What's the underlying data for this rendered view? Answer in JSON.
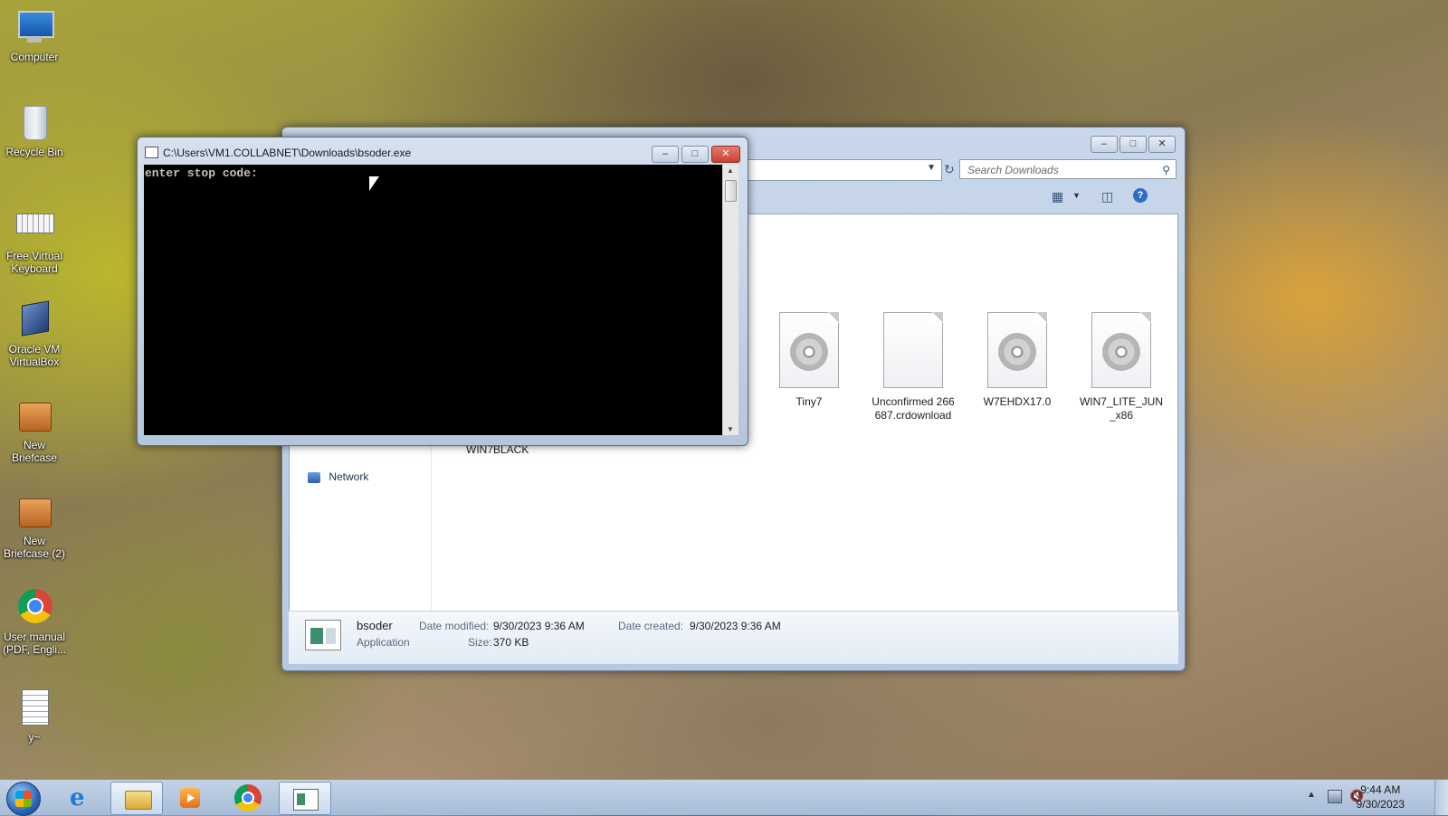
{
  "desktop": {
    "icons": [
      {
        "label": "Computer"
      },
      {
        "label": "Recycle Bin"
      },
      {
        "label": "Free Virtual Keyboard"
      },
      {
        "label": "Oracle VM VirtualBox"
      },
      {
        "label": "New Briefcase"
      },
      {
        "label": "New Briefcase (2)"
      },
      {
        "label": "User manual (PDF, Engli..."
      },
      {
        "label": "y~"
      }
    ]
  },
  "explorer": {
    "search_placeholder": "Search Downloads",
    "nav_network": "Network",
    "partial_item": "WIN7BLACK",
    "files": [
      {
        "name": "Tiny7",
        "icon": "disc-image-icon"
      },
      {
        "name": "Unconfirmed 266687.crdownload",
        "icon": "blank-file-icon"
      },
      {
        "name": "W7EHDX17.0",
        "icon": "disc-image-icon"
      },
      {
        "name": "WIN7_LITE_JUN_x86",
        "icon": "disc-image-icon"
      }
    ],
    "details": {
      "name": "bsoder",
      "type": "Application",
      "modified_label": "Date modified:",
      "modified_value": "9/30/2023 9:36 AM",
      "size_label": "Size:",
      "size_value": "370 KB",
      "created_label": "Date created:",
      "created_value": "9/30/2023 9:36 AM"
    }
  },
  "console": {
    "title": "C:\\Users\\VM1.COLLABNET\\Downloads\\bsoder.exe",
    "output": "enter stop code:"
  },
  "taskbar": {
    "time": "9:44 AM",
    "date": "9/30/2023"
  },
  "colors": {
    "console_bg": "#000000",
    "console_text": "#c0c0c0",
    "close_button": "#c9402f"
  }
}
